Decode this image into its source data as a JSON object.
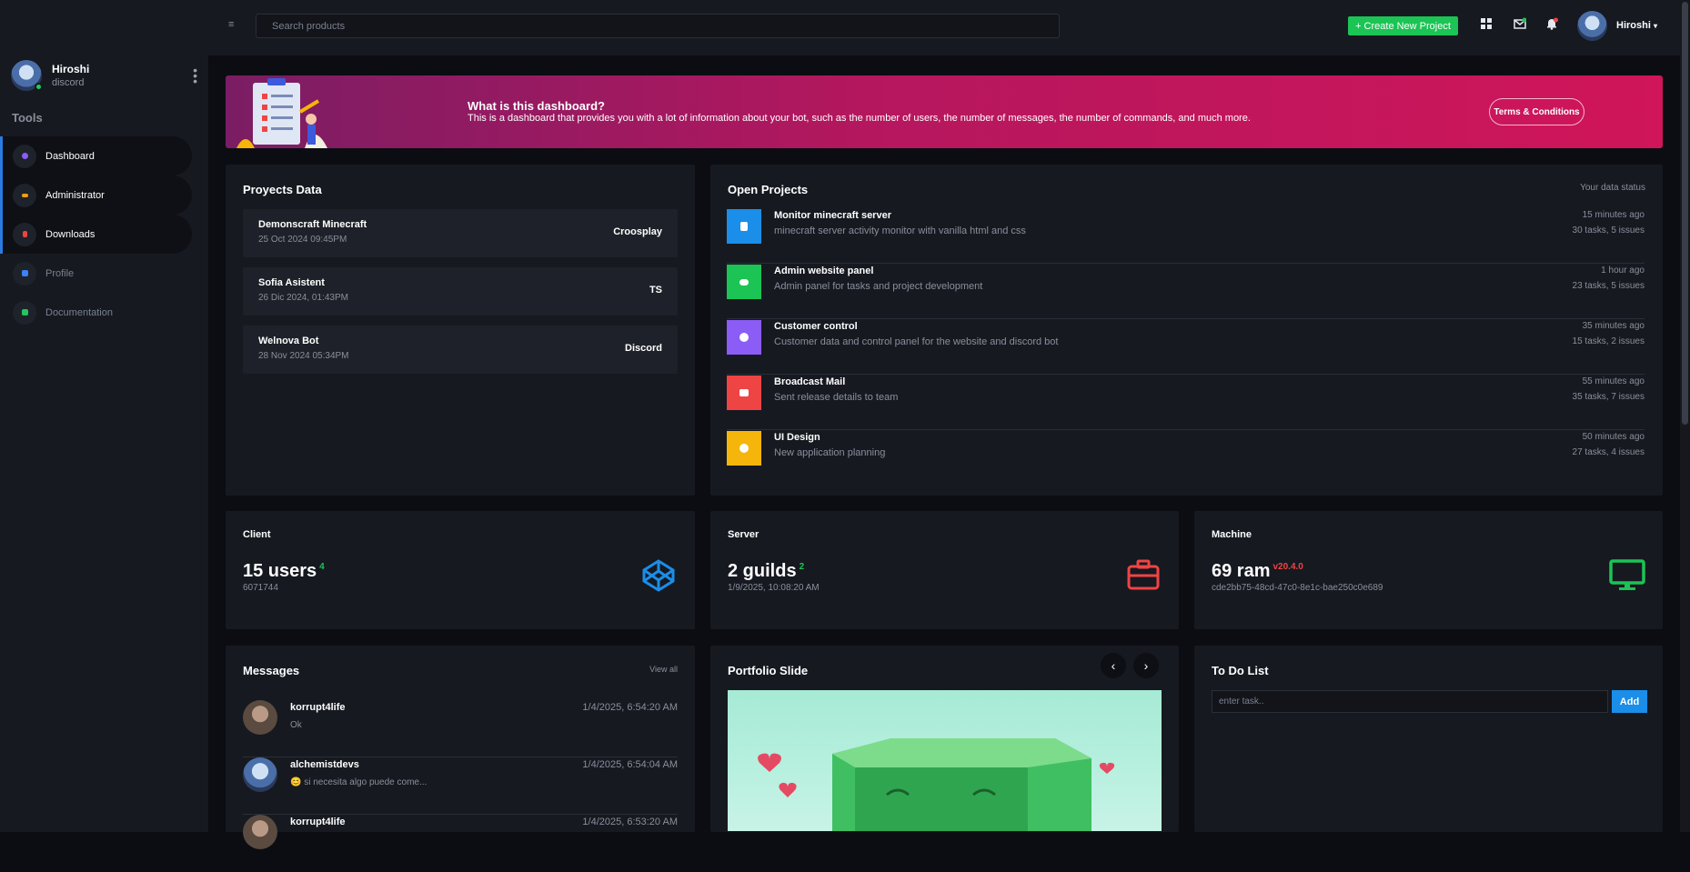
{
  "sidebar": {
    "user": {
      "name": "Hiroshi",
      "sub": "discord"
    },
    "section": "Tools",
    "items": [
      {
        "label": "Dashboard",
        "color": "#8b5cf6"
      },
      {
        "label": "Administrator",
        "color": "#f59e0b"
      },
      {
        "label": "Downloads",
        "color": "#ef4444"
      },
      {
        "label": "Profile",
        "color": "#3b82f6"
      },
      {
        "label": "Documentation",
        "color": "#22c55e"
      }
    ]
  },
  "topbar": {
    "search_placeholder": "Search products",
    "create_label": "+ Create New Project",
    "user_name": "Hiroshi",
    "icons": [
      "grid-icon",
      "mail-icon",
      "bell-icon"
    ]
  },
  "banner": {
    "title": "What is this dashboard?",
    "desc": "This is a dashboard that provides you with a lot of information about your bot, such as the number of users, the number of messages, the number of commands, and much more.",
    "terms": "Terms & Conditions"
  },
  "proyects": {
    "title": "Proyects Data",
    "rows": [
      {
        "name": "Demonscraft Minecraft",
        "date": "25 Oct 2024 09:45PM",
        "tag": "Croosplay"
      },
      {
        "name": "Sofia Asistent",
        "date": "26 Dic 2024, 01:43PM",
        "tag": "TS"
      },
      {
        "name": "Welnova Bot",
        "date": "28 Nov 2024 05:34PM",
        "tag": "Discord"
      }
    ]
  },
  "open_projects": {
    "title": "Open Projects",
    "status": "Your data status",
    "rows": [
      {
        "name": "Monitor minecraft server",
        "desc": "minecraft server activity monitor with vanilla html and css",
        "time": "15 minutes ago",
        "tasks": "30 tasks, 5 issues",
        "color": "#1a8ee8"
      },
      {
        "name": "Admin website panel",
        "desc": "Admin panel for tasks and project development",
        "time": "1 hour ago",
        "tasks": "23 tasks, 5 issues",
        "color": "#1bc454"
      },
      {
        "name": "Customer control",
        "desc": "Customer data and control panel for the website and discord bot",
        "time": "35 minutes ago",
        "tasks": "15 tasks, 2 issues",
        "color": "#8b5cf6"
      },
      {
        "name": "Broadcast Mail",
        "desc": "Sent release details to team",
        "time": "55 minutes ago",
        "tasks": "35 tasks, 7 issues",
        "color": "#ef4444"
      },
      {
        "name": "UI Design",
        "desc": "New application planning",
        "time": "50 minutes ago",
        "tasks": "27 tasks, 4 issues",
        "color": "#f5b50a"
      }
    ]
  },
  "client": {
    "title": "Client",
    "value": "15 users",
    "badge": "4",
    "sub": "6071744",
    "badge_color": "#1bc454",
    "icon_color": "#1a8ee8"
  },
  "server": {
    "title": "Server",
    "value": "2 guilds",
    "badge": "2",
    "sub": "1/9/2025, 10:08:20 AM",
    "badge_color": "#1bc454",
    "icon_color": "#ef4444"
  },
  "machine": {
    "title": "Machine",
    "value": "69 ram",
    "badge": "v20.4.0",
    "sub": "cde2bb75-48cd-47c0-8e1c-bae250c0e689",
    "badge_color": "#ef4444",
    "icon_color": "#1bc454"
  },
  "messages": {
    "title": "Messages",
    "view_all": "View all",
    "rows": [
      {
        "user": "korrupt4life",
        "text": "Ok",
        "date": "1/4/2025, 6:54:20 AM"
      },
      {
        "user": "alchemistdevs",
        "text": "😊 si necesita algo puede come...",
        "date": "1/4/2025, 6:54:04 AM"
      },
      {
        "user": "korrupt4life",
        "text": "",
        "date": "1/4/2025, 6:53:20 AM"
      }
    ]
  },
  "portfolio": {
    "title": "Portfolio Slide",
    "prev": "‹",
    "next": "›"
  },
  "todo": {
    "title": "To Do List",
    "placeholder": "enter task..",
    "add": "Add"
  }
}
